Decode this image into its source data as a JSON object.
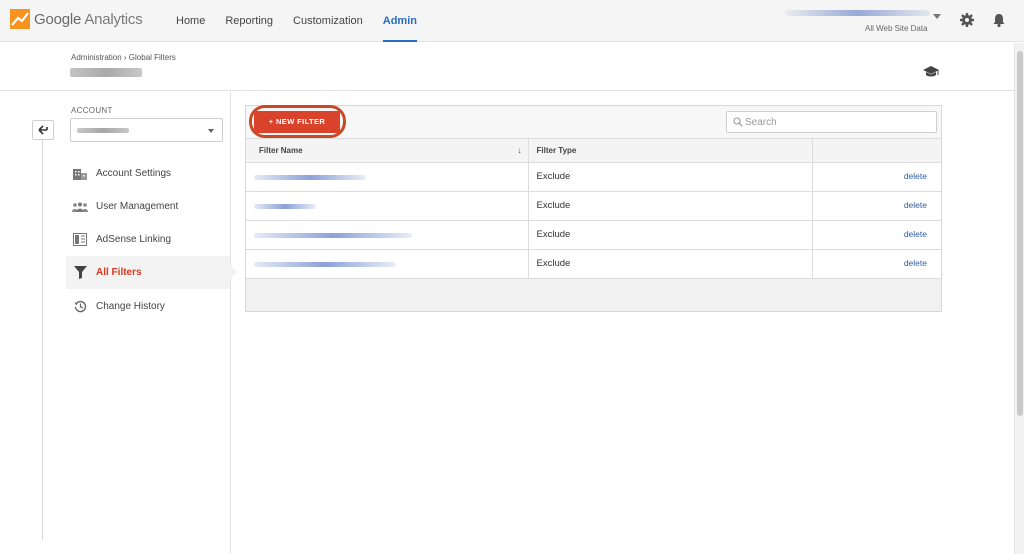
{
  "app": {
    "logo_google": "Google",
    "logo_product": "Analytics"
  },
  "nav": {
    "items": [
      {
        "label": "Home",
        "active": false
      },
      {
        "label": "Reporting",
        "active": false
      },
      {
        "label": "Customization",
        "active": false
      },
      {
        "label": "Admin",
        "active": true
      }
    ]
  },
  "account_switcher": {
    "subtitle": "All Web Site Data"
  },
  "header": {
    "breadcrumb": "Administration › Global Filters"
  },
  "sidebar": {
    "account_label": "ACCOUNT",
    "items": [
      {
        "label": "Account Settings",
        "icon": "building-icon",
        "active": false
      },
      {
        "label": "User Management",
        "icon": "users-icon",
        "active": false
      },
      {
        "label": "AdSense Linking",
        "icon": "adsense-icon",
        "active": false
      },
      {
        "label": "All Filters",
        "icon": "funnel-icon",
        "active": true
      },
      {
        "label": "Change History",
        "icon": "history-icon",
        "active": false
      }
    ]
  },
  "filters": {
    "new_button_label": "+ NEW FILTER",
    "search_placeholder": "Search",
    "columns": {
      "name": "Filter Name",
      "sort_indicator": "↓",
      "type": "Filter Type"
    },
    "rows": [
      {
        "type": "Exclude",
        "action": "delete"
      },
      {
        "type": "Exclude",
        "action": "delete"
      },
      {
        "type": "Exclude",
        "action": "delete"
      },
      {
        "type": "Exclude",
        "action": "delete"
      }
    ]
  },
  "colors": {
    "accent_blue": "#2b6cc4",
    "brand_orange": "#f7931e",
    "button_red": "#d9432b",
    "highlight_ring": "#c84a25",
    "active_sidebar_text": "#d93a22"
  }
}
